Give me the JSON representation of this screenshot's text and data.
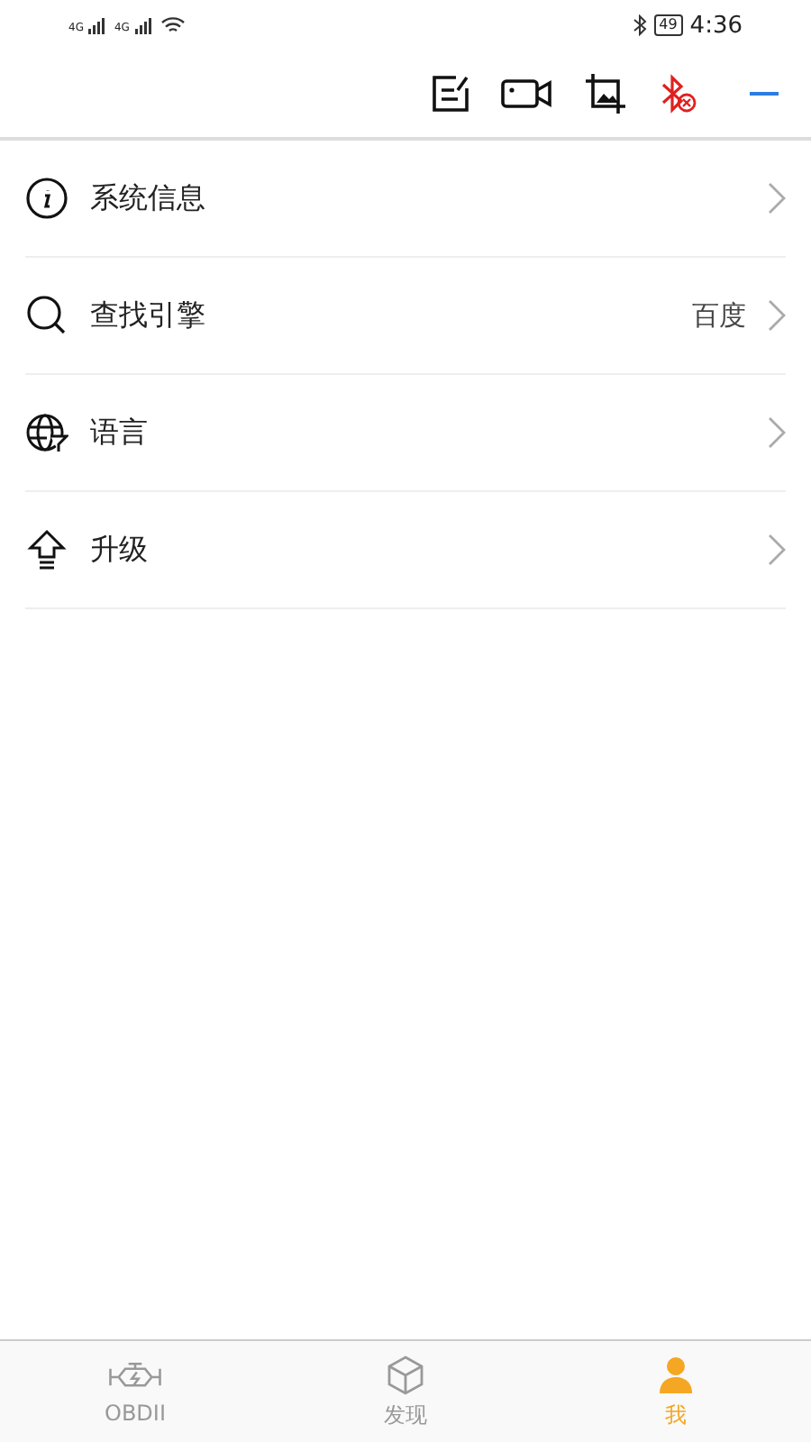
{
  "status_bar": {
    "networks": [
      "4G",
      "4G"
    ],
    "battery": "49",
    "time": "4:36"
  },
  "menu": [
    {
      "label": "系统信息"
    },
    {
      "label": "查找引擎",
      "value": "百度"
    },
    {
      "label": "语言"
    },
    {
      "label": "升级"
    }
  ],
  "tabs": [
    {
      "label": "OBDII",
      "selected": false
    },
    {
      "label": "发现",
      "selected": false
    },
    {
      "label": "我",
      "selected": true
    }
  ]
}
